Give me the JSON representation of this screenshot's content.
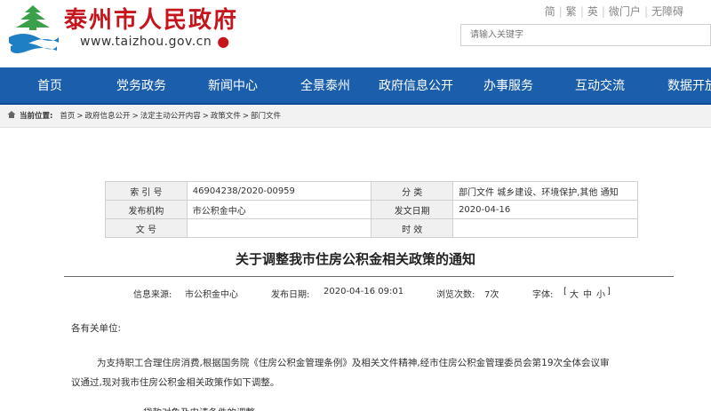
{
  "header": {
    "site_title": "泰州市人民政府",
    "site_url": "www.taizhou.gov.cn",
    "top_links": [
      "简",
      "繁",
      "英",
      "微门户",
      "无障碍"
    ],
    "search_placeholder": "请输入关键字",
    "colors": {
      "brand_red": "#c4161c",
      "logo_green": "#3aa04a",
      "logo_blue": "#1e7fc4"
    }
  },
  "nav": {
    "items": [
      "首页",
      "党务政务",
      "新闻中心",
      "全景泰州",
      "政府信息公开",
      "办事服务",
      "互动交流",
      "数据开放"
    ],
    "color": "#1b5eab"
  },
  "breadcrumb": {
    "label": "当前位置:",
    "items": [
      "首页",
      "政府信息公开",
      "法定主动公开内容",
      "政策文件",
      "部门文件"
    ]
  },
  "info": {
    "index_label": "索 引 号",
    "index_value": "46904238/2020-00959",
    "category_label": "分 类",
    "category_value": "部门文件 城乡建设、环境保护,其他 通知",
    "issuer_label": "发布机构",
    "issuer_value": "市公积金中心",
    "date_label": "发文日期",
    "date_value": "2020-04-16",
    "docno_label": "文 号",
    "docno_value": "",
    "validity_label": "时 效",
    "validity_value": ""
  },
  "article": {
    "title": "关于调整我市住房公积金相关政策的通知",
    "meta": {
      "source": "信息来源:",
      "source_value": "市公积金中心",
      "published": "发布日期:",
      "published_value": "2020-04-16 09:01",
      "views": "浏览次数:",
      "views_value": "7次",
      "font": "字体:",
      "size_open": "[",
      "size_large": "大",
      "size_medium": "中",
      "size_small": "小",
      "size_close": "]"
    },
    "greeting": "各有关单位:",
    "paragraph1": "为支持职工合理住房消费,根据国务院《住房公积金管理条例》及相关文件精神,经市住房公积金管理委员会第19次全体会议审议通过,现对我市住房公积金相关政策作如下调整。",
    "paragraph2": "一、贷款对象及申请条件的调整"
  }
}
